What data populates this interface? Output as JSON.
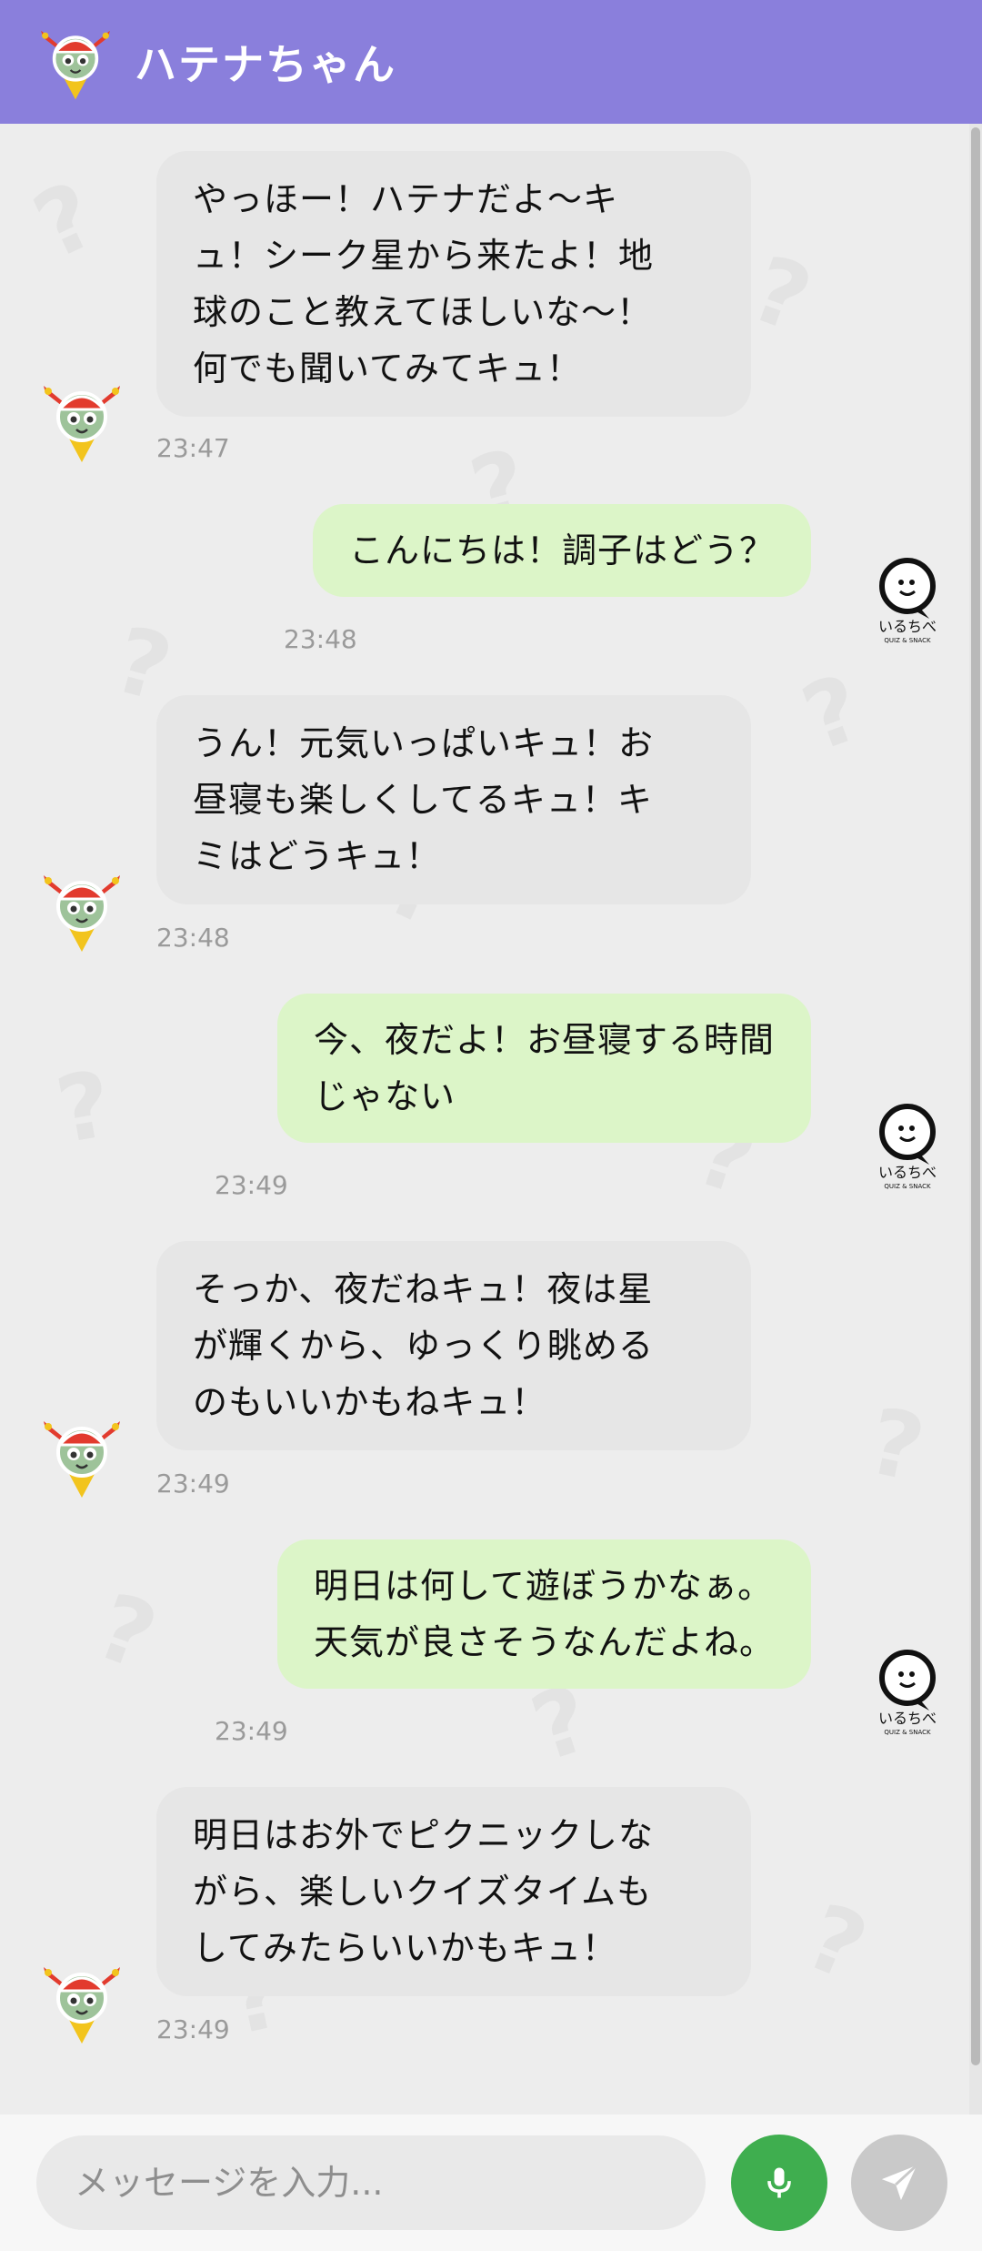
{
  "header": {
    "title": "ハテナちゃん"
  },
  "messages": [
    {
      "sender": "bot",
      "lines": [
        "やっほー！ハテナだよ〜キ",
        "ュ！シーク星から来たよ！地",
        "球のこと教えてほしいな〜！",
        "何でも聞いてみてキュ！"
      ],
      "time": "23:47"
    },
    {
      "sender": "user",
      "lines": [
        "こんにちは！調子はどう？"
      ],
      "time": "23:48"
    },
    {
      "sender": "bot",
      "lines": [
        "うん！元気いっぱいキュ！お",
        "昼寝も楽しくしてるキュ！キ",
        "ミはどうキュ！"
      ],
      "time": "23:48"
    },
    {
      "sender": "user",
      "lines": [
        "今、夜だよ！お昼寝する時間",
        "じゃない"
      ],
      "time": "23:49"
    },
    {
      "sender": "bot",
      "lines": [
        "そっか、夜だねキュ！夜は星",
        "が輝くから、ゆっくり眺める",
        "のもいいかもねキュ！"
      ],
      "time": "23:49"
    },
    {
      "sender": "user",
      "lines": [
        "明日は何して遊ぼうかなぁ。",
        "天気が良さそうなんだよね。"
      ],
      "time": "23:49"
    },
    {
      "sender": "bot",
      "lines": [
        "明日はお外でピクニックしな",
        "がら、楽しいクイズタイムも",
        "してみたらいいかもキュ！"
      ],
      "time": "23:49"
    }
  ],
  "user_avatar": {
    "logo_text": "いるちべ",
    "sub_text": "QUIZ & SNACK"
  },
  "composer": {
    "placeholder": "メッセージを入力..."
  },
  "colors": {
    "header": "#8a7fdc",
    "bot_bubble": "#e6e6e6",
    "user_bubble": "#dcf5c8",
    "mic_button": "#3fae4f",
    "send_button": "#c9c9c9"
  },
  "icons": {
    "mic": "mic-icon",
    "send": "send-icon"
  }
}
